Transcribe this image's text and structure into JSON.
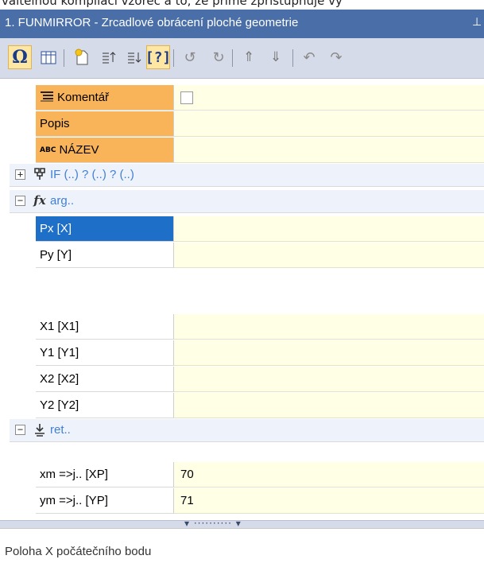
{
  "top_strip_text": "vaitelnou kompilaci vzorec a to, ze prime zpristupnuje vy",
  "window": {
    "title": "1. FUNMIRROR - Zrcadlové obrácení ploché geometrie",
    "pin_icon": "pin-icon"
  },
  "toolbar": {
    "buttons": [
      {
        "name": "omega-button",
        "glyph": "Ω",
        "active": true
      },
      {
        "name": "grid-button",
        "glyph": "▦"
      },
      {
        "name": "new-button",
        "glyph": "✦"
      },
      {
        "name": "sort-asc-button",
        "glyph": "⇡"
      },
      {
        "name": "sort-desc-button",
        "glyph": "⇣"
      },
      {
        "name": "help-button",
        "glyph": "?",
        "active": true
      },
      {
        "name": "rotate-left-button",
        "glyph": "↺"
      },
      {
        "name": "rotate-right-button",
        "glyph": "↻"
      },
      {
        "name": "move-up-button",
        "glyph": "⇑"
      },
      {
        "name": "move-down-button",
        "glyph": "⇓"
      },
      {
        "name": "undo-button",
        "glyph": "↶"
      },
      {
        "name": "redo-button",
        "glyph": "↷"
      }
    ]
  },
  "properties": {
    "comment_label": "Komentář",
    "description_label": "Popis",
    "name_label": "NÁZEV",
    "name_icon_text": "ABC"
  },
  "groups": {
    "if": {
      "label": "IF (..) ? (..) ? (..)",
      "expander": "+"
    },
    "arg": {
      "label": "arg..",
      "expander": "−"
    },
    "ret": {
      "label": "ret..",
      "expander": "−"
    }
  },
  "args": [
    {
      "label": "Px [X]",
      "value": "",
      "selected": true
    },
    {
      "label": "Py [Y]",
      "value": ""
    },
    {
      "label": "",
      "value": ""
    },
    {
      "label": "X1 [X1]",
      "value": ""
    },
    {
      "label": "Y1 [Y1]",
      "value": ""
    },
    {
      "label": "X2 [X2]",
      "value": ""
    },
    {
      "label": "Y2 [Y2]",
      "value": ""
    }
  ],
  "rets": [
    {
      "label": "xm =>j.. [XP]",
      "value": "70"
    },
    {
      "label": "ym =>j.. [YP]",
      "value": "71"
    }
  ],
  "splitter_grip": "▾ ·········· ▾",
  "status_description": "Poloha X počátečního bodu"
}
